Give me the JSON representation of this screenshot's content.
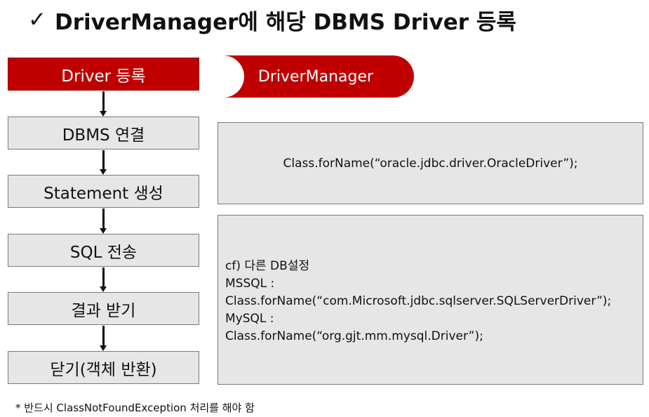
{
  "title": {
    "check": "✓",
    "text": "DriverManager에 해당 DBMS Driver 등록"
  },
  "steps": [
    {
      "label": "Driver 등록",
      "active": true
    },
    {
      "label": "DBMS 연결",
      "active": false
    },
    {
      "label": "Statement 생성",
      "active": false
    },
    {
      "label": "SQL 전송",
      "active": false
    },
    {
      "label": "결과 받기",
      "active": false
    },
    {
      "label": "닫기(객체 반환)",
      "active": false
    }
  ],
  "driver_manager": {
    "label": "DriverManager"
  },
  "code_box_1": {
    "text": "Class.forName(“oracle.jdbc.driver.OracleDriver”);"
  },
  "code_box_2": {
    "lines": [
      "cf) 다른 DB설정",
      "MSSQL :",
      "Class.forName(“com.Microsoft.jdbc.sqlserver.SQLServerDriver”);",
      "MySQL :",
      "Class.forName(“org.gjt.mm.mysql.Driver”);"
    ]
  },
  "footnote": "* 반드시 ClassNotFoundException 처리를 해야 함",
  "colors": {
    "accent": "#c00000",
    "box_fill": "#e6e6e6",
    "box_border": "#7a7a7a"
  }
}
